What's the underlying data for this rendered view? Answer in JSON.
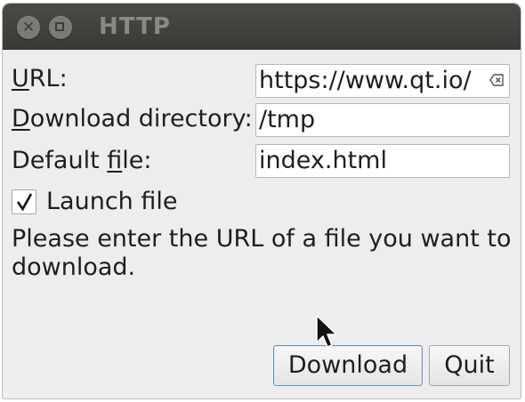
{
  "window": {
    "title": "HTTP"
  },
  "form": {
    "url_label": "URL:",
    "url_value": "https://www.qt.io/",
    "download_dir_label": "Download directory:",
    "download_dir_value": "/tmp",
    "default_file_label": "Default file:",
    "default_file_value": "index.html",
    "launch_checkbox_label": "Launch file",
    "launch_checked": true
  },
  "status": {
    "message": "Please enter the URL of a file you want to download."
  },
  "buttons": {
    "download_label": "Download",
    "quit_label": "Quit"
  },
  "icons": {
    "close": "close-icon",
    "minimize": "minimize-icon",
    "clear": "clear-text-icon",
    "check": "checkmark-icon",
    "cursor": "mouse-pointer-icon"
  }
}
